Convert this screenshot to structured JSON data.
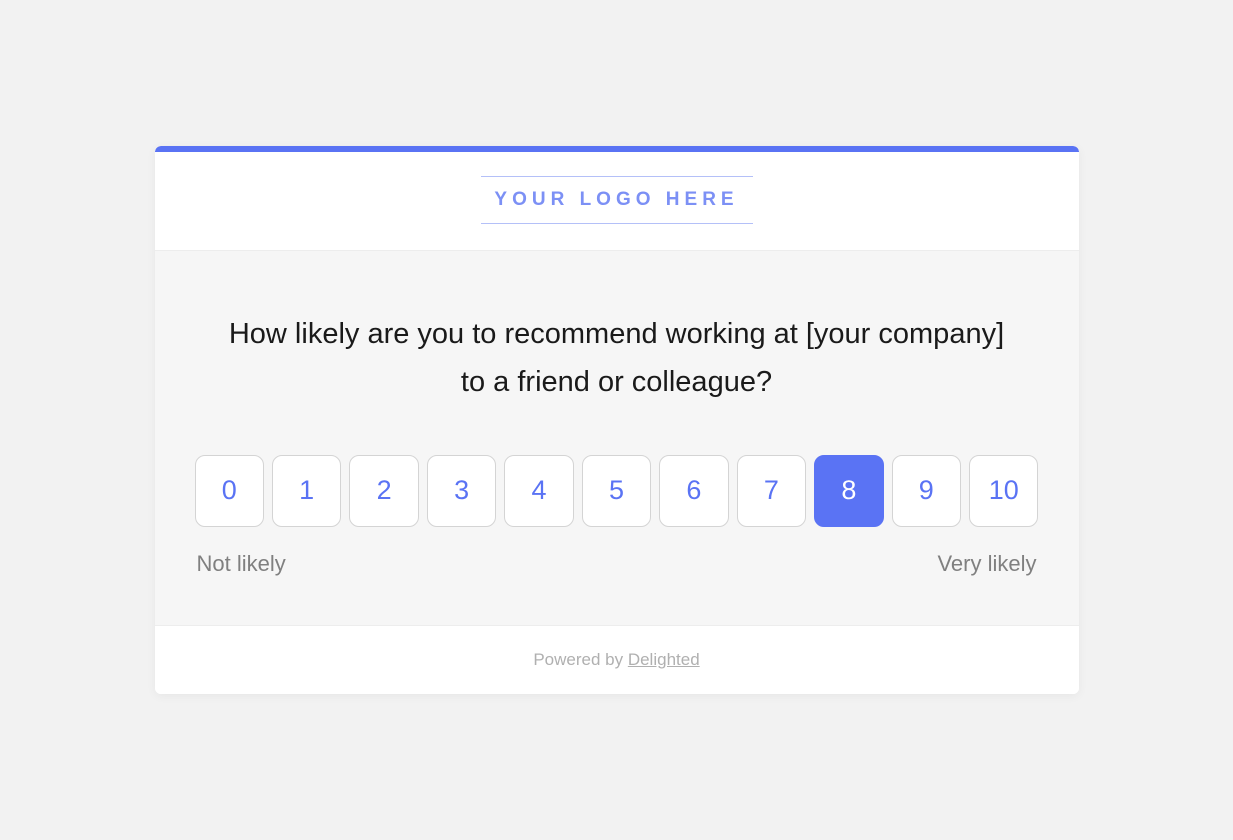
{
  "colors": {
    "accent": "#5a73f4",
    "page_bg": "#f2f2f2",
    "question_bg": "#f6f6f6"
  },
  "logo": {
    "placeholder_text": "YOUR LOGO HERE"
  },
  "question": {
    "text": "How likely are you to recommend working at [your company] to a friend or colleague?"
  },
  "scale": {
    "options": [
      "0",
      "1",
      "2",
      "3",
      "4",
      "5",
      "6",
      "7",
      "8",
      "9",
      "10"
    ],
    "selected_index": 8,
    "low_label": "Not likely",
    "high_label": "Very likely"
  },
  "footer": {
    "prefix": "Powered by ",
    "link_text": "Delighted"
  }
}
